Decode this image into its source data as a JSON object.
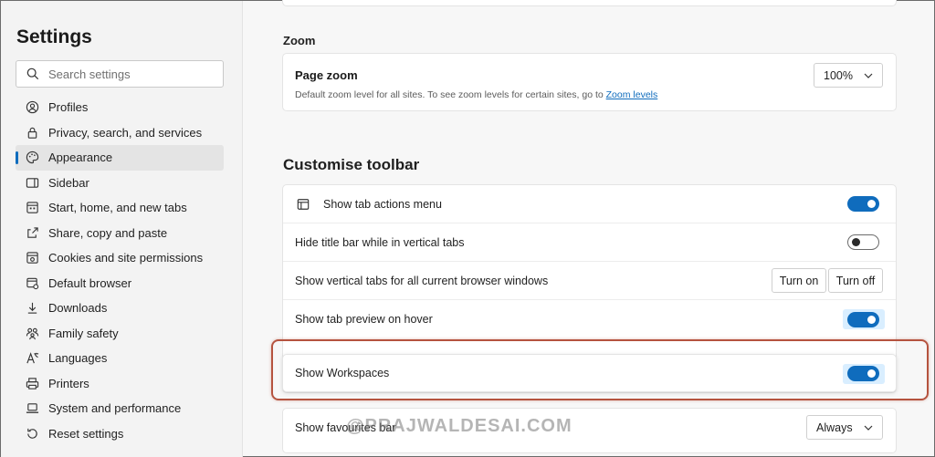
{
  "sidebar": {
    "title": "Settings",
    "search_placeholder": "Search settings",
    "items": [
      {
        "label": "Profiles",
        "icon": "profile-icon"
      },
      {
        "label": "Privacy, search, and services",
        "icon": "lock-icon"
      },
      {
        "label": "Appearance",
        "icon": "palette-icon",
        "active": true
      },
      {
        "label": "Sidebar",
        "icon": "sidebar-icon"
      },
      {
        "label": "Start, home, and new tabs",
        "icon": "home-tabs-icon"
      },
      {
        "label": "Share, copy and paste",
        "icon": "share-icon"
      },
      {
        "label": "Cookies and site permissions",
        "icon": "cookie-icon"
      },
      {
        "label": "Default browser",
        "icon": "browser-icon"
      },
      {
        "label": "Downloads",
        "icon": "download-icon"
      },
      {
        "label": "Family safety",
        "icon": "family-icon"
      },
      {
        "label": "Languages",
        "icon": "language-icon"
      },
      {
        "label": "Printers",
        "icon": "printer-icon"
      },
      {
        "label": "System and performance",
        "icon": "laptop-icon"
      },
      {
        "label": "Reset settings",
        "icon": "reset-icon"
      }
    ]
  },
  "zoom": {
    "section": "Zoom",
    "title": "Page zoom",
    "description": "Default zoom level for all sites. To see zoom levels for certain sites, go to",
    "link": "Zoom levels",
    "value": "100%"
  },
  "toolbar": {
    "heading": "Customise toolbar",
    "rows": [
      {
        "label": "Show tab actions menu",
        "state": "on"
      },
      {
        "label": "Hide title bar while in vertical tabs",
        "state": "off"
      },
      {
        "label": "Show vertical tabs for all current browser windows",
        "button_on": "Turn on",
        "button_off": "Turn off"
      },
      {
        "label": "Show tab preview on hover",
        "state": "on"
      }
    ],
    "workspaces": {
      "label": "Show Workspaces",
      "state": "on"
    },
    "favourites": {
      "label": "Show favourites bar",
      "value": "Always"
    }
  },
  "watermark": "@PRAJWALDESAI.COM",
  "colors": {
    "accent": "#0f6cbd",
    "highlight": "#b5533f"
  }
}
